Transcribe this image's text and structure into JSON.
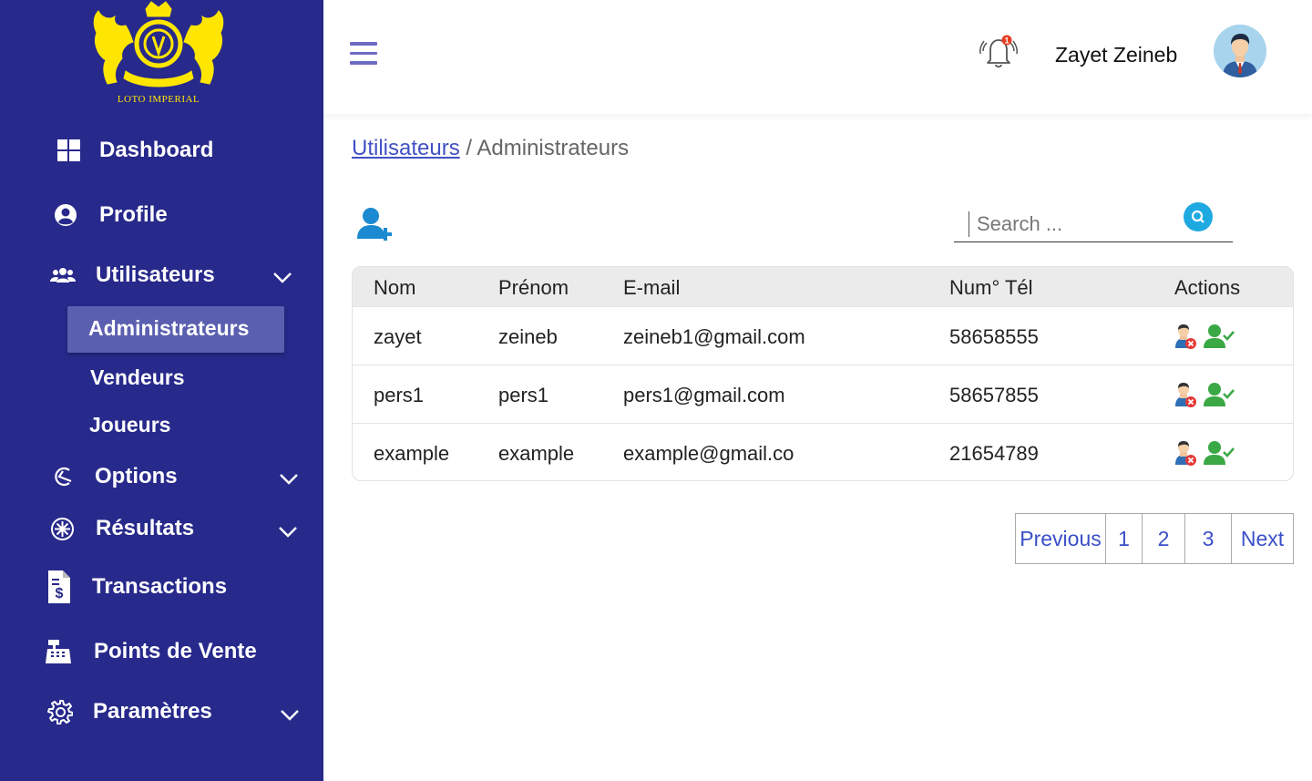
{
  "brand": {
    "logo_text": "LOTO IMPERIAL",
    "color_primary": "#27298b",
    "color_logo": "#ffe600"
  },
  "sidebar": {
    "items": [
      {
        "label": "Dashboard",
        "icon": "dashboard-icon"
      },
      {
        "label": "Profile",
        "icon": "user-circle-icon"
      },
      {
        "label": "Utilisateurs",
        "icon": "users-icon",
        "expanded": true
      },
      {
        "label": "Options",
        "icon": "options-icon"
      },
      {
        "label": "Résultats",
        "icon": "results-icon"
      },
      {
        "label": "Transactions",
        "icon": "receipt-dollar-icon"
      },
      {
        "label": "Points de Vente",
        "icon": "cash-register-icon"
      },
      {
        "label": "Paramètres",
        "icon": "gear-icon"
      }
    ],
    "subitems": [
      {
        "label": "Administrateurs",
        "active": true
      },
      {
        "label": "Vendeurs"
      },
      {
        "label": "Joueurs"
      }
    ]
  },
  "header": {
    "username": "Zayet Zeineb",
    "notification_count": "1"
  },
  "breadcrumb": {
    "parent": "Utilisateurs",
    "separator": " / ",
    "current": "Administrateurs"
  },
  "search": {
    "placeholder": "Search ..."
  },
  "table": {
    "columns": [
      "Nom",
      "Prénom",
      "E-mail",
      "Num° Tél",
      "Actions"
    ],
    "rows": [
      {
        "nom": "zayet",
        "prenom": "zeineb",
        "email": "zeineb1@gmail.com",
        "tel": "58658555"
      },
      {
        "nom": "pers1",
        "prenom": "pers1",
        "email": "pers1@gmail.com",
        "tel": "58657855"
      },
      {
        "nom": "example",
        "prenom": "example",
        "email": "example@gmail.co",
        "tel": "21654789"
      }
    ]
  },
  "pagination": {
    "previous": "Previous",
    "pages": [
      "1",
      "2",
      "3"
    ],
    "next": "Next"
  }
}
